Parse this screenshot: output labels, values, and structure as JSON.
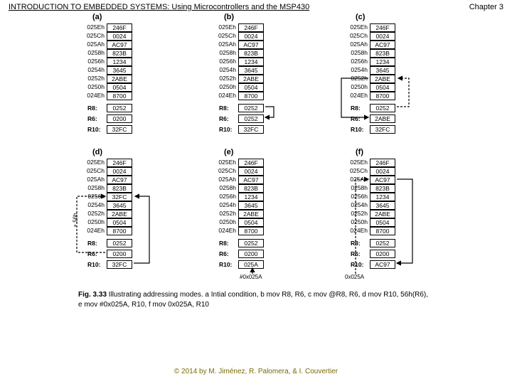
{
  "header": {
    "title": "INTRODUCTION TO EMBEDDED SYSTEMS: Using Microcontrollers and the MSP430",
    "chapter": "Chapter 3"
  },
  "panels": [
    {
      "label": "(a)",
      "mem": [
        {
          "addr": "025Eh",
          "val": "246F"
        },
        {
          "addr": "025Ch",
          "val": "0024"
        },
        {
          "addr": "025Ah",
          "val": "AC97"
        },
        {
          "addr": "0258h",
          "val": "823B"
        },
        {
          "addr": "0256h",
          "val": "1234"
        },
        {
          "addr": "0254h",
          "val": "3645"
        },
        {
          "addr": "0252h",
          "val": "2ABE"
        },
        {
          "addr": "0250h",
          "val": "0504"
        },
        {
          "addr": "024Eh",
          "val": "8700"
        }
      ],
      "regs": [
        {
          "label": "R8:",
          "val": "0252"
        },
        {
          "label": "R6:",
          "val": "0200"
        },
        {
          "label": "R10:",
          "val": "32FC"
        }
      ]
    },
    {
      "label": "(b)",
      "mem": [
        {
          "addr": "025Eh",
          "val": "246F"
        },
        {
          "addr": "025Ch",
          "val": "0024"
        },
        {
          "addr": "025Ah",
          "val": "AC97"
        },
        {
          "addr": "0258h",
          "val": "823B"
        },
        {
          "addr": "0256h",
          "val": "1234"
        },
        {
          "addr": "0254h",
          "val": "3645"
        },
        {
          "addr": "0252h",
          "val": "2ABE"
        },
        {
          "addr": "0250h",
          "val": "0504"
        },
        {
          "addr": "024Eh",
          "val": "8700"
        }
      ],
      "regs": [
        {
          "label": "R8:",
          "val": "0252"
        },
        {
          "label": "R6:",
          "val": "0252"
        },
        {
          "label": "R10:",
          "val": "32FC"
        }
      ]
    },
    {
      "label": "(c)",
      "mem": [
        {
          "addr": "025Eh",
          "val": "246F"
        },
        {
          "addr": "025Ch",
          "val": "0024"
        },
        {
          "addr": "025Ah",
          "val": "AC97"
        },
        {
          "addr": "0258h",
          "val": "823B"
        },
        {
          "addr": "0256h",
          "val": "1234"
        },
        {
          "addr": "0254h",
          "val": "3645"
        },
        {
          "addr": "0252h",
          "val": "2ABE"
        },
        {
          "addr": "0250h",
          "val": "0504"
        },
        {
          "addr": "024Eh",
          "val": "8700"
        }
      ],
      "regs": [
        {
          "label": "R8:",
          "val": "0252"
        },
        {
          "label": "R6:",
          "val": "2ABE"
        },
        {
          "label": "R10:",
          "val": "32FC"
        }
      ]
    },
    {
      "label": "(d)",
      "mem": [
        {
          "addr": "025Eh",
          "val": "246F"
        },
        {
          "addr": "025Ch",
          "val": "0024"
        },
        {
          "addr": "025Ah",
          "val": "AC97"
        },
        {
          "addr": "0258h",
          "val": "823B"
        },
        {
          "addr": "0256h",
          "val": "32FC"
        },
        {
          "addr": "0254h",
          "val": "3645"
        },
        {
          "addr": "0252h",
          "val": "2ABE"
        },
        {
          "addr": "0250h",
          "val": "0504"
        },
        {
          "addr": "024Eh",
          "val": "8700"
        }
      ],
      "regs": [
        {
          "label": "R8:",
          "val": "0252"
        },
        {
          "label": "R6:",
          "val": "0200"
        },
        {
          "label": "R10:",
          "val": "32FC"
        }
      ],
      "annot": "+ 56h"
    },
    {
      "label": "(e)",
      "mem": [
        {
          "addr": "025Eh",
          "val": "246F"
        },
        {
          "addr": "025Ch",
          "val": "0024"
        },
        {
          "addr": "025Ah",
          "val": "AC97"
        },
        {
          "addr": "0258h",
          "val": "823B"
        },
        {
          "addr": "0256h",
          "val": "1234"
        },
        {
          "addr": "0254h",
          "val": "3645"
        },
        {
          "addr": "0252h",
          "val": "2ABE"
        },
        {
          "addr": "0250h",
          "val": "0504"
        },
        {
          "addr": "024Eh",
          "val": "8700"
        }
      ],
      "regs": [
        {
          "label": "R8:",
          "val": "0252"
        },
        {
          "label": "R6:",
          "val": "0200"
        },
        {
          "label": "R10:",
          "val": "025A"
        }
      ],
      "annot2": "#0x025A"
    },
    {
      "label": "(f)",
      "mem": [
        {
          "addr": "025Eh",
          "val": "246F"
        },
        {
          "addr": "025Ch",
          "val": "0024"
        },
        {
          "addr": "025Ah",
          "val": "AC97"
        },
        {
          "addr": "0258h",
          "val": "823B"
        },
        {
          "addr": "0256h",
          "val": "1234"
        },
        {
          "addr": "0254h",
          "val": "3645"
        },
        {
          "addr": "0252h",
          "val": "2ABE"
        },
        {
          "addr": "0250h",
          "val": "0504"
        },
        {
          "addr": "024Eh",
          "val": "8700"
        }
      ],
      "regs": [
        {
          "label": "R8:",
          "val": "0252"
        },
        {
          "label": "R6:",
          "val": "0200"
        },
        {
          "label": "R10:",
          "val": "AC97"
        }
      ],
      "annot2": "0x025A"
    }
  ],
  "caption": {
    "label": "Fig. 3.33",
    "text": "Illustrating addressing modes. a Intial condition, b mov R8, R6, c mov @R8, R6, d mov R10, 56h(R6), e mov #0x025A, R10, f mov 0x025A, R10"
  },
  "footer": "© 2014 by M. Jiménez, R. Palomera, & I. Couvertier"
}
